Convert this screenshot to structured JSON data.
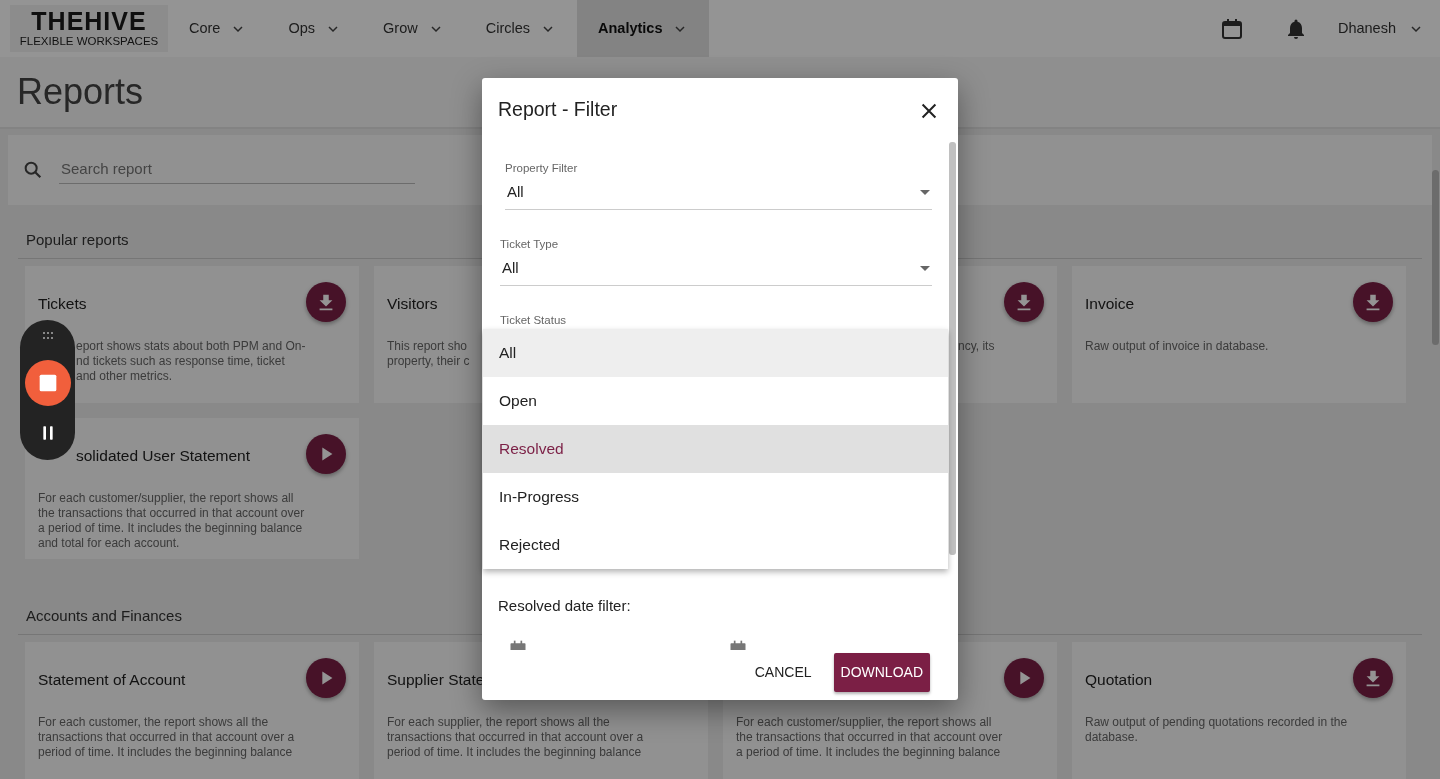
{
  "nav": {
    "logo_title": "THEHIVE",
    "logo_subtitle": "FLEXIBLE WORKSPACES",
    "items": [
      {
        "label": "Core",
        "selected": false
      },
      {
        "label": "Ops",
        "selected": false
      },
      {
        "label": "Grow",
        "selected": false
      },
      {
        "label": "Circles",
        "selected": false
      },
      {
        "label": "Analytics",
        "selected": true
      }
    ],
    "user": "Dhanesh"
  },
  "page_title": "Reports",
  "search": {
    "placeholder": "Search report"
  },
  "sections": [
    {
      "title": "Popular reports",
      "cards": [
        {
          "title": "Tickets",
          "kind": "download",
          "lines": [
            "eport shows stats about both PPM and On-",
            "nd tickets such as response time, ticket",
            "and other metrics."
          ]
        },
        {
          "title": "Visitors",
          "lines": [
            "This report sho",
            "property, their c"
          ]
        },
        {
          "kind": "download",
          "lines": [
            "ncy, its"
          ]
        },
        {
          "title": "Invoice",
          "kind": "download",
          "lines": [
            "Raw output of invoice in database."
          ]
        },
        {
          "title": "solidated User Statement",
          "kind": "play",
          "lines": [
            "For each customer/supplier, the report shows all",
            "the transactions that occurred in that account over",
            "a period of time. It includes the beginning balance",
            "and total for each account."
          ]
        }
      ]
    },
    {
      "title": "Accounts and Finances",
      "cards": [
        {
          "title": "Statement of Account",
          "kind": "play",
          "lines": [
            "For each customer, the report shows all the",
            "transactions that occurred in that account over a",
            "period of time. It includes the beginning balance"
          ]
        },
        {
          "title": "Supplier State",
          "lines": [
            "For each supplier, the report shows all the",
            "transactions that occurred in that account over a",
            "period of time. It includes the beginning balance"
          ]
        },
        {
          "kind": "play",
          "lines": [
            "For each customer/supplier, the report shows all",
            "the transactions that occurred in that account over",
            "a period of time. It includes the beginning balance"
          ]
        },
        {
          "title": "Quotation",
          "kind": "download",
          "lines": [
            "Raw output of pending quotations recorded in the",
            "database."
          ]
        }
      ]
    }
  ],
  "dialog": {
    "title": "Report - Filter",
    "fields": [
      {
        "label": "Property Filter",
        "value": "All"
      },
      {
        "label": "Ticket Type",
        "value": "All"
      },
      {
        "label": "Ticket Status"
      }
    ],
    "menu": [
      {
        "label": "All",
        "selected": false,
        "highlighted": true
      },
      {
        "label": "Open",
        "selected": false,
        "highlighted": false
      },
      {
        "label": "Resolved",
        "selected": true,
        "highlighted": false
      },
      {
        "label": "In-Progress",
        "selected": false,
        "highlighted": false
      },
      {
        "label": "Rejected",
        "selected": false,
        "highlighted": false
      }
    ],
    "date_filter_label": "Resolved date filter:",
    "buttons": [
      {
        "label": "CANCEL",
        "kind": "text"
      },
      {
        "label": "DOWNLOAD",
        "kind": "primary"
      }
    ]
  }
}
